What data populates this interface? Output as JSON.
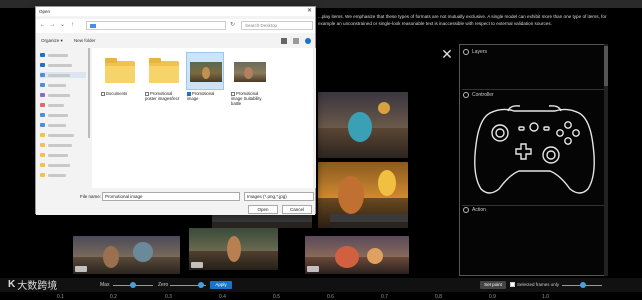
{
  "banner": {
    "text": "...play items. We emphasize that these types of formats are not mutually exclusive. A single model can exhibit more than one type of items, for example an unconstrained or single-look reasonable text is inaccessible with respect to external validation sources."
  },
  "right_panel": {
    "sections": [
      {
        "label": "Layers"
      },
      {
        "label": "Controller"
      },
      {
        "label": "Action"
      }
    ]
  },
  "bottom_bar": {
    "label_a": "Max",
    "label_b": "Zero",
    "apply_label": "Apply",
    "ok_label": "Set point",
    "selected_only_label": "Selected frames only",
    "timeline_ticks": [
      "0.1",
      "0.2",
      "0.3",
      "0.4",
      "0.5",
      "0.6",
      "0.7",
      "0.8",
      "0.9",
      "1.0"
    ]
  },
  "logo": {
    "mark": "K",
    "text": "大数跨境"
  },
  "dialog": {
    "title": "Open",
    "address": "",
    "search_placeholder": "Search Desktop",
    "toolbar": {
      "organize": "Organize ▾",
      "new_folder": "New folder"
    },
    "files": [
      {
        "name": "Documents",
        "kind": "folder",
        "selected": false
      },
      {
        "name": "Promotional poster images/lect",
        "kind": "folder",
        "selected": false
      },
      {
        "name": "Promotional image",
        "kind": "image",
        "selected": true
      },
      {
        "name": "Promotional image Suitability battle",
        "kind": "image",
        "selected": false
      }
    ],
    "filename_label": "File name:",
    "filename_value": "Promotional image",
    "filetype_value": "Images (*.png,*.jpg)",
    "open_label": "Open",
    "cancel_label": "Cancel"
  },
  "colors": {
    "accent": "#1a73c7",
    "folder": "#f1c24e",
    "selection": "#cce4f7"
  }
}
